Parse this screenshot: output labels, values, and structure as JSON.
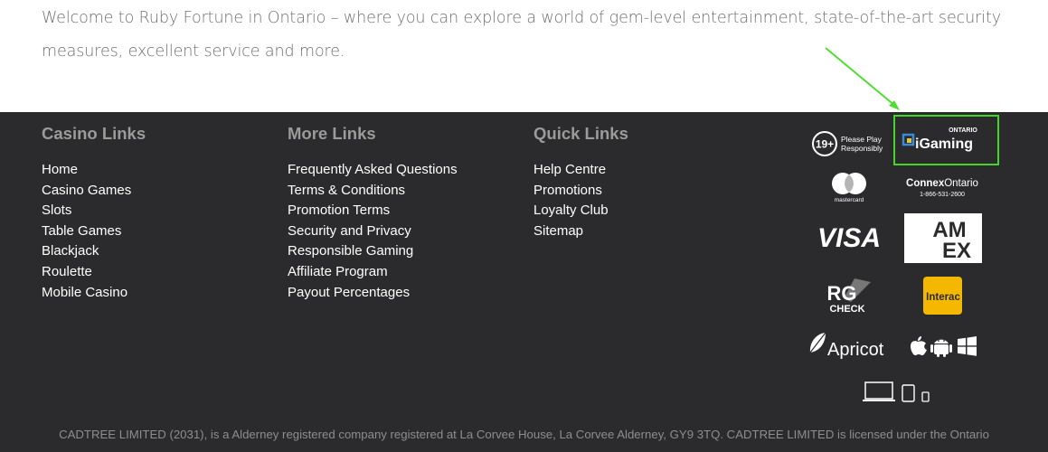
{
  "intro": {
    "text": "Welcome to Ruby Fortune in Ontario – where you can explore a world of gem-level entertainment, state-of-the-art security measures, excellent service and more."
  },
  "footer": {
    "columns": [
      {
        "heading": "Casino Links",
        "links": [
          "Home",
          "Casino Games",
          "Slots",
          "Table Games",
          "Blackjack",
          "Roulette",
          "Mobile Casino"
        ]
      },
      {
        "heading": "More Links",
        "links": [
          "Frequently Asked Questions",
          "Terms & Conditions",
          "Promotion Terms",
          "Security and Privacy",
          "Responsible Gaming",
          "Affiliate Program",
          "Payout Percentages"
        ]
      },
      {
        "heading": "Quick Links",
        "links": [
          "Help Centre",
          "Promotions",
          "Loyalty Club",
          "Sitemap"
        ]
      }
    ],
    "logos": {
      "age_badge": "19+",
      "play_responsibly": [
        "Please Play",
        "Responsibly"
      ],
      "igaming_region": "ONTARIO",
      "igaming_name": "iGaming",
      "mastercard_label": "mastercard",
      "connex_bold": "Connex",
      "connex_rest": "Ontario",
      "connex_phone": "1-866-531-2600",
      "visa": "VISA",
      "amex_top": "AM",
      "amex_bottom": "EX",
      "rg_top": "RG",
      "rg_bottom": "CHECK",
      "interac": "Interac",
      "apricot": "Apricot"
    },
    "legal_text": "CADTREE LIMITED (2031), is a Alderney registered company registered at La Corvee House, La Corvee Alderney, GY9 3TQ. CADTREE LIMITED is licensed under the Ontario"
  },
  "colors": {
    "footer_bg": "#2b2a2c",
    "heading": "#9b9b9b",
    "link": "#ffffff",
    "highlight_box": "#44d52a"
  }
}
